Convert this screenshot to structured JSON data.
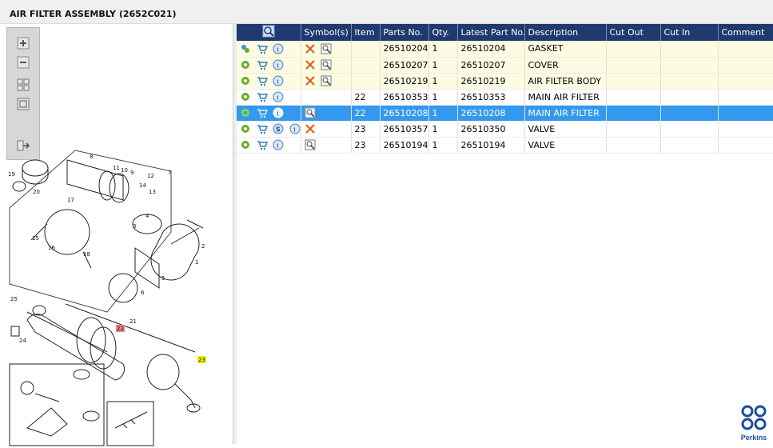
{
  "window": {
    "title": "AIR FILTER ASSEMBLY (2652C021)"
  },
  "toolbar": {
    "buttons": [
      {
        "icon": "zoom-in-icon"
      },
      {
        "icon": "zoom-out-icon"
      },
      {
        "icon": "fit-all-icon"
      },
      {
        "icon": "fit-window-icon"
      },
      {
        "icon": "export-icon"
      }
    ]
  },
  "table": {
    "headers": {
      "symbols": "Symbol(s)",
      "item": "Item",
      "part_no": "Parts No.",
      "qty": "Qty.",
      "latest": "Latest Part No.",
      "description": "Description",
      "cut_out": "Cut Out",
      "cut_in": "Cut In",
      "comment": "Comment"
    },
    "rows": [
      {
        "item": "",
        "part_no": "26510204",
        "qty": "1",
        "latest": "26510204",
        "description": "GASKET",
        "cut_out": "",
        "cut_in": "",
        "comment": ""
      },
      {
        "item": "",
        "part_no": "26510207",
        "qty": "1",
        "latest": "26510207",
        "description": "COVER",
        "cut_out": "",
        "cut_in": "",
        "comment": ""
      },
      {
        "item": "",
        "part_no": "26510219",
        "qty": "1",
        "latest": "26510219",
        "description": "AIR FILTER BODY",
        "cut_out": "",
        "cut_in": "",
        "comment": ""
      },
      {
        "item": "22",
        "part_no": "26510353",
        "qty": "1",
        "latest": "26510353",
        "description": "MAIN AIR FILTER",
        "cut_out": "",
        "cut_in": "",
        "comment": ""
      },
      {
        "item": "22",
        "part_no": "26510208",
        "qty": "1",
        "latest": "26510208",
        "description": "MAIN AIR FILTER",
        "cut_out": "",
        "cut_in": "",
        "comment": ""
      },
      {
        "item": "23",
        "part_no": "26510357",
        "qty": "1",
        "latest": "26510350",
        "description": "VALVE",
        "cut_out": "",
        "cut_in": "",
        "comment": ""
      },
      {
        "item": "23",
        "part_no": "26510194",
        "qty": "1",
        "latest": "26510194",
        "description": "VALVE",
        "cut_out": "",
        "cut_in": "",
        "comment": ""
      }
    ]
  },
  "diagram": {
    "callouts": [
      "19",
      "20",
      "8",
      "11",
      "10",
      "9",
      "12",
      "7",
      "17",
      "14",
      "13",
      "15",
      "3",
      "4",
      "2",
      "16",
      "18",
      "1",
      "25",
      "5",
      "6",
      "21",
      "22",
      "24",
      "23"
    ]
  },
  "logo": {
    "text": "Perkins"
  },
  "colors": {
    "header_bg": "#1f3a6e",
    "selected_row": "#3399ee",
    "highlight_row": "#fdfbe1",
    "callout_red": "#f08080",
    "callout_yellow": "#f0f000"
  }
}
